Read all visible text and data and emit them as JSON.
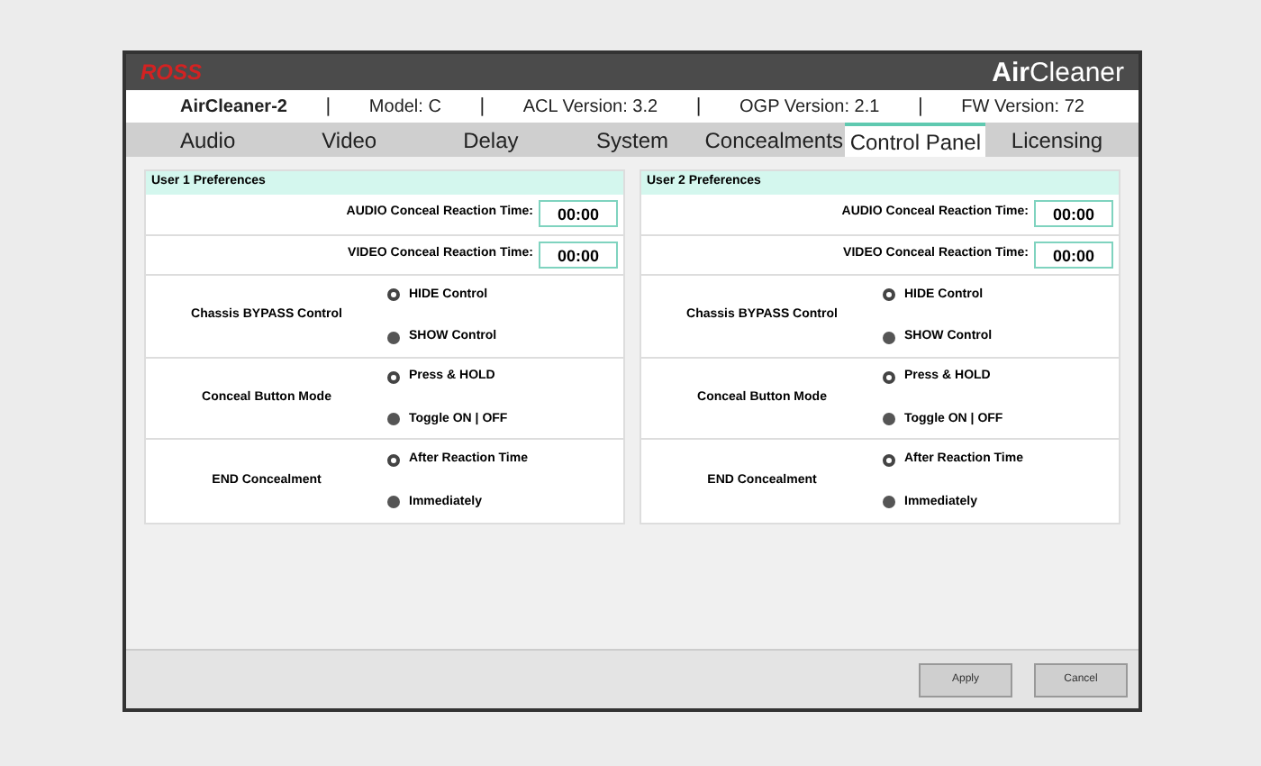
{
  "header": {
    "logo": "ROSS",
    "brand": "**Air**Cleaner"
  },
  "info_bar": {
    "device": "AirCleaner-2",
    "separator": "|",
    "model": "Model: C",
    "acl": "ACL Version: 3.2",
    "ogp": "OGP Version: 2.1",
    "fw": "FW Version: 72"
  },
  "tabs": [
    {
      "label": "Audio",
      "selected": false
    },
    {
      "label": "Video",
      "selected": false
    },
    {
      "label": "Delay",
      "selected": false
    },
    {
      "label": "System",
      "selected": false
    },
    {
      "label": "Concealments",
      "selected": false
    },
    {
      "label": "Control Panel",
      "selected": true
    },
    {
      "label": "Licensing",
      "selected": false
    }
  ],
  "panels": [
    {
      "title": "User 1 Preferences",
      "times": [
        {
          "label": "AUDIO Conceal Reaction Time:",
          "value": "00:00"
        },
        {
          "label": "VIDEO Conceal Reaction Time:",
          "value": "00:00"
        }
      ],
      "groups": [
        {
          "label": "Chassis BYPASS Control",
          "options": [
            {
              "label": "HIDE Control",
              "selected": true
            },
            {
              "label": "SHOW Control",
              "selected": false
            }
          ]
        },
        {
          "label": "Conceal Button Mode",
          "options": [
            {
              "label": "Press & HOLD",
              "selected": true
            },
            {
              "label": "Toggle ON | OFF",
              "selected": false
            }
          ]
        },
        {
          "label": "END Concealment",
          "options": [
            {
              "label": "After Reaction Time",
              "selected": true
            },
            {
              "label": "Immediately",
              "selected": false
            }
          ]
        }
      ]
    },
    {
      "title": "User 2 Preferences",
      "times": [
        {
          "label": "AUDIO Conceal Reaction Time:",
          "value": "00:00"
        },
        {
          "label": "VIDEO Conceal Reaction Time:",
          "value": "00:00"
        }
      ],
      "groups": [
        {
          "label": "Chassis BYPASS Control",
          "options": [
            {
              "label": "HIDE Control",
              "selected": true
            },
            {
              "label": "SHOW Control",
              "selected": false
            }
          ]
        },
        {
          "label": "Conceal Button Mode",
          "options": [
            {
              "label": "Press & HOLD",
              "selected": true
            },
            {
              "label": "Toggle ON | OFF",
              "selected": false
            }
          ]
        },
        {
          "label": "END Concealment",
          "options": [
            {
              "label": "After Reaction Time",
              "selected": true
            },
            {
              "label": "Immediately",
              "selected": false
            }
          ]
        }
      ]
    }
  ],
  "buttons": [
    "Apply",
    "Cancel"
  ]
}
